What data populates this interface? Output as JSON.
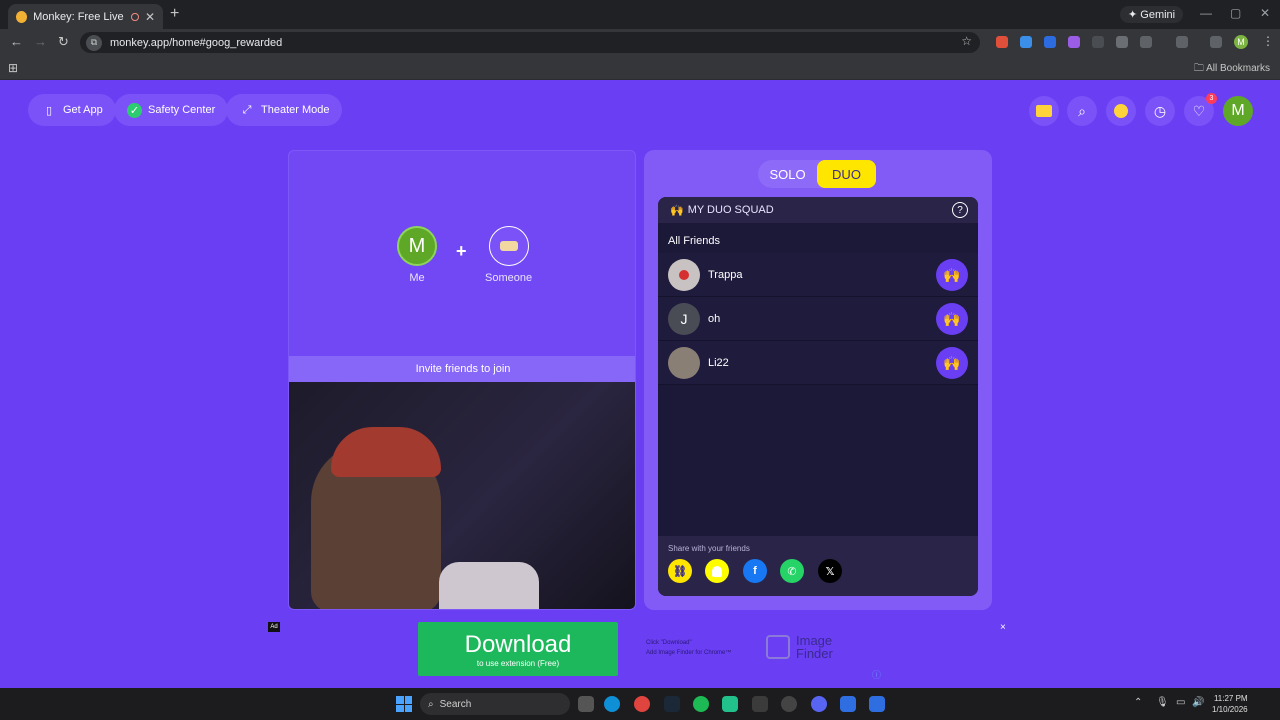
{
  "browser": {
    "tab_title": "Monkey: Free Live Video Ch",
    "new_tab": "+",
    "gemini_label": "Gemini",
    "url": "monkey.app/home#goog_rewarded",
    "all_bookmarks": "All Bookmarks",
    "profile_initial": "M"
  },
  "header": {
    "get_app": "Get App",
    "safety_center": "Safety Center",
    "theater_mode": "Theater Mode",
    "notification_count": "3",
    "avatar_initial": "M"
  },
  "left_panel": {
    "me_initial": "M",
    "me_label": "Me",
    "someone_label": "Someone",
    "plus": "+",
    "invite_text": "Invite friends to join"
  },
  "right_panel": {
    "solo": "SOLO",
    "duo": "DUO",
    "squad_title": "MY DUO SQUAD",
    "squad_emoji": "🙌",
    "help": "?",
    "all_friends": "All Friends",
    "friends": [
      {
        "name": "Trappa",
        "initial": ""
      },
      {
        "name": "oh",
        "initial": "J"
      },
      {
        "name": "Li22",
        "initial": ""
      }
    ],
    "hands_emoji": "🙌",
    "share_text": "Share with your friends"
  },
  "ad": {
    "tag": "Ad",
    "download": "Download",
    "download_sub": "to use extension (Free)",
    "copy_line1": "Click \"Download\"",
    "copy_line2": "Add Image Finder for Chrome™",
    "finder_line1": "Image",
    "finder_line2": "Finder",
    "close": "×"
  },
  "taskbar": {
    "search": "Search",
    "time": "11:27 PM",
    "date": "1/10/2026"
  },
  "colors": {
    "page_bg": "#6a3ef3",
    "accent_yellow": "#ffe600",
    "download_green": "#1db85c",
    "avatar_green": "#5fa827"
  }
}
